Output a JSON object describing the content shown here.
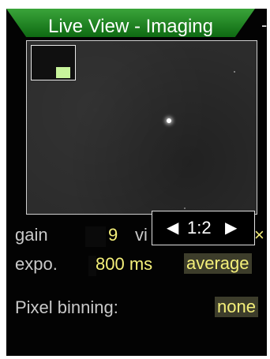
{
  "header": {
    "title": "Live View - Imaging",
    "trailing": "-"
  },
  "preview": {
    "zoom_prev_icon": "◀",
    "zoom_level": "1:2",
    "zoom_next_icon": "▶"
  },
  "settings": {
    "gain": {
      "label": "gain",
      "value": "9"
    },
    "view": {
      "label_partial": "vi",
      "close_mark": "×"
    },
    "exposure": {
      "label": "expo.",
      "value": "800 ms",
      "mode": "average"
    },
    "binning": {
      "label": "Pixel binning:",
      "value": "none"
    }
  },
  "colors": {
    "title_bar": "#1f8a24",
    "accent_value": "#f5f07a",
    "minimap_viewport": "#c7f39b"
  }
}
